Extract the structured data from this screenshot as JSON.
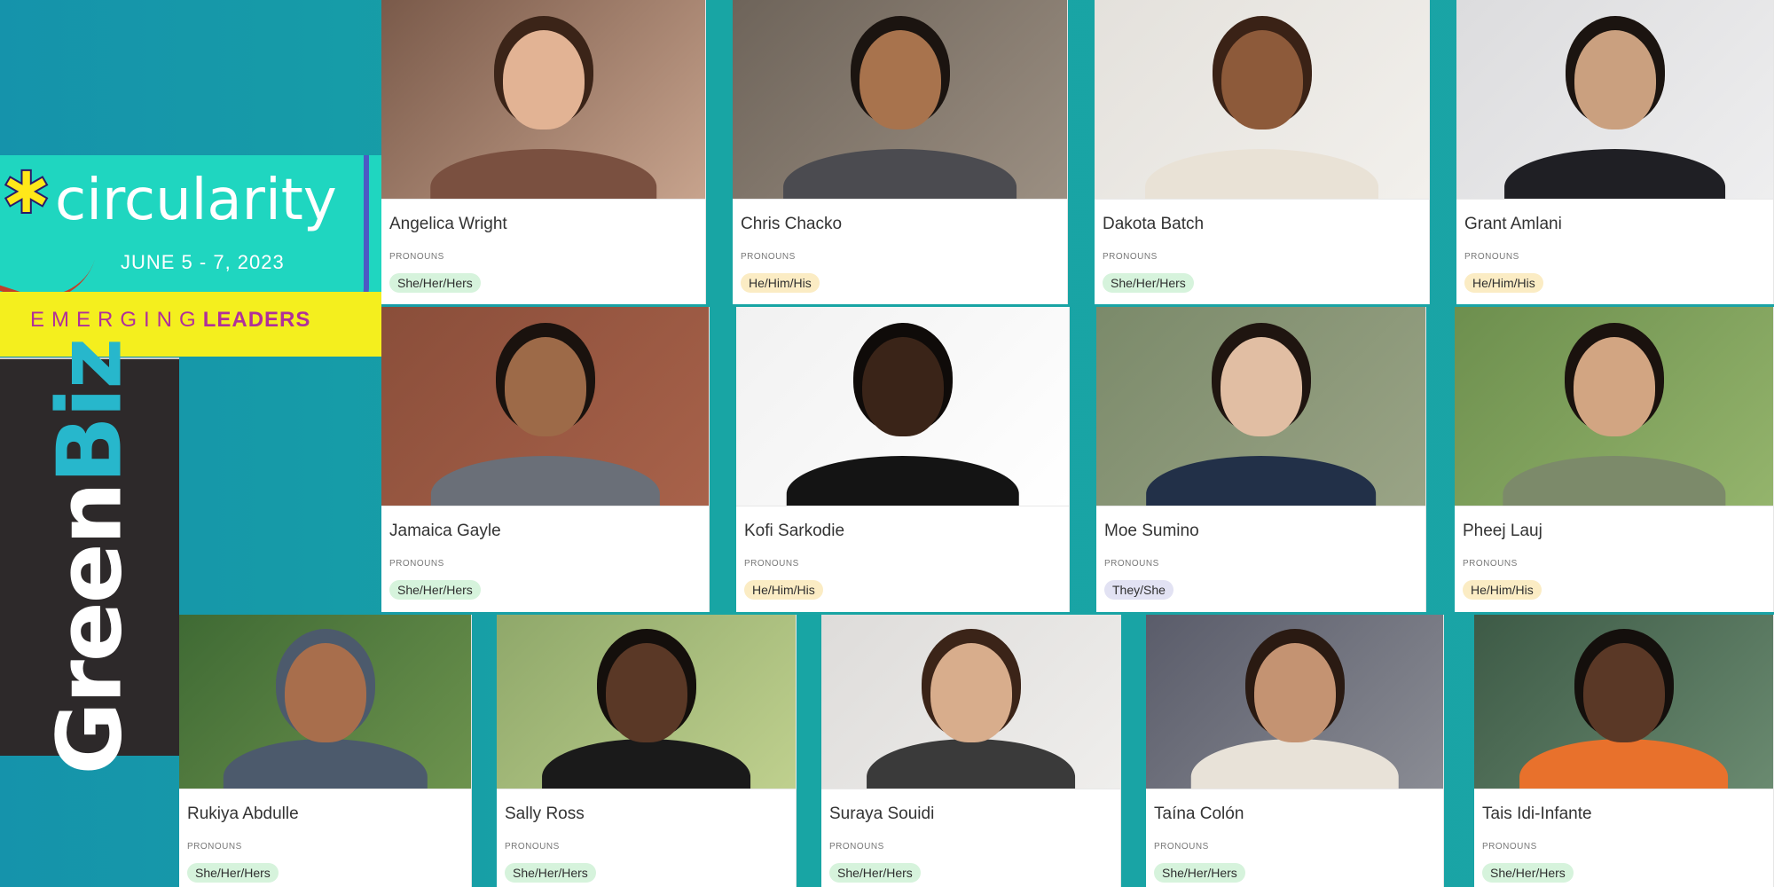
{
  "brand": {
    "event": "circularity",
    "dates": "JUNE 5 - 7, 2023",
    "program_left": "EMERGING",
    "program_right": "LEADERS",
    "publisher_a": "Green",
    "publisher_b": "Biz"
  },
  "pronoun_label": "PRONOUNS",
  "people": [
    {
      "name": "Angelica Wright",
      "pronouns": "She/Her/Hers"
    },
    {
      "name": "Chris Chacko",
      "pronouns": "He/Him/His"
    },
    {
      "name": "Dakota Batch",
      "pronouns": "She/Her/Hers"
    },
    {
      "name": "Grant Amlani",
      "pronouns": "He/Him/His"
    },
    {
      "name": "Jamaica Gayle",
      "pronouns": "She/Her/Hers"
    },
    {
      "name": "Kofi Sarkodie",
      "pronouns": "He/Him/His"
    },
    {
      "name": "Moe Sumino",
      "pronouns": "They/She"
    },
    {
      "name": "Pheej Lauj",
      "pronouns": "He/Him/His"
    },
    {
      "name": "Rukiya Abdulle",
      "pronouns": "She/Her/Hers"
    },
    {
      "name": "Sally Ross",
      "pronouns": "She/Her/Hers"
    },
    {
      "name": "Suraya Souidi",
      "pronouns": "She/Her/Hers"
    },
    {
      "name": "Taína Colón",
      "pronouns": "She/Her/Hers"
    },
    {
      "name": "Tais Idi-Infante",
      "pronouns": "She/Her/Hers"
    }
  ],
  "colors": {
    "background": "#18a5a4",
    "tag_she": "#d6f3dc",
    "tag_he": "#fbecc4",
    "tag_they": "#e2e2f3",
    "banner": "#1fd6c0",
    "leaders_bar": "#f4ef1e",
    "greenbiz_panel": "#2d292a"
  }
}
